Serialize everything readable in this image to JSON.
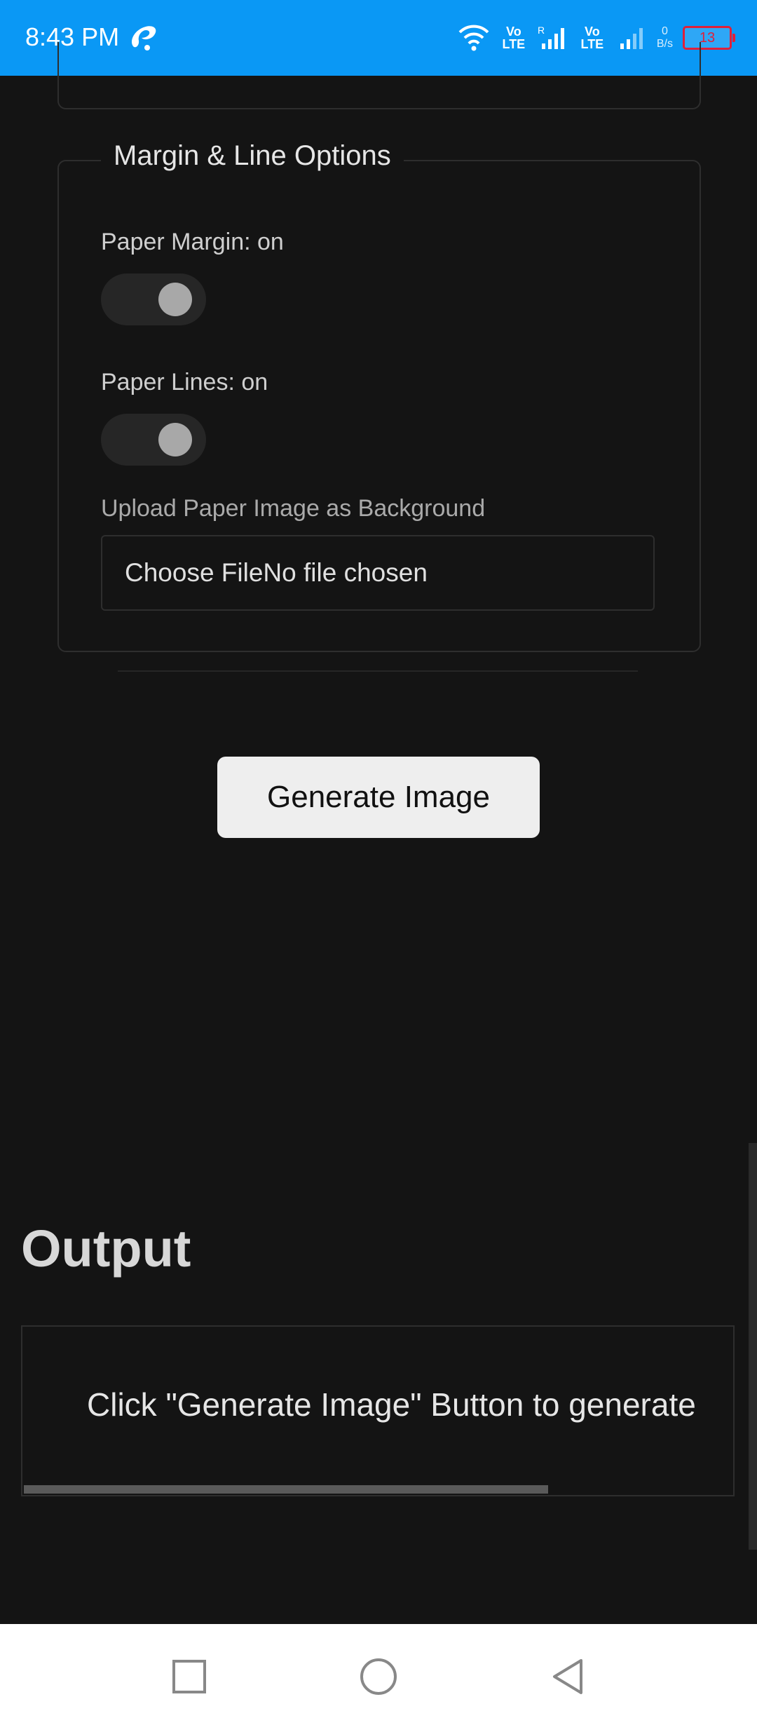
{
  "status_bar": {
    "time": "8:43 PM",
    "net1": "Vo LTE",
    "net2": "Vo LTE",
    "roaming": "R",
    "speed_value": "0",
    "speed_unit": "B/s",
    "battery": "13",
    "icons": [
      "carrier-icon",
      "wifi-icon",
      "signal-icon",
      "battery-icon"
    ]
  },
  "margin_section": {
    "legend": "Margin & Line Options",
    "paper_margin_label": "Paper Margin: on",
    "paper_margin_on": true,
    "paper_lines_label": "Paper Lines: on",
    "paper_lines_on": true,
    "upload_label": "Upload Paper Image as Background",
    "file_input_text": "Choose FileNo file chosen"
  },
  "generate_button": "Generate Image",
  "output": {
    "heading": "Output",
    "placeholder": "Click \"Generate Image\" Button to generate"
  },
  "nav_bar": {
    "icons": [
      "recents-square-icon",
      "home-circle-icon",
      "back-triangle-icon"
    ]
  },
  "colors": {
    "status_bar": "#0a98f5",
    "background": "#141414",
    "button": "#eeeeee",
    "battery_low": "#e0203a"
  }
}
